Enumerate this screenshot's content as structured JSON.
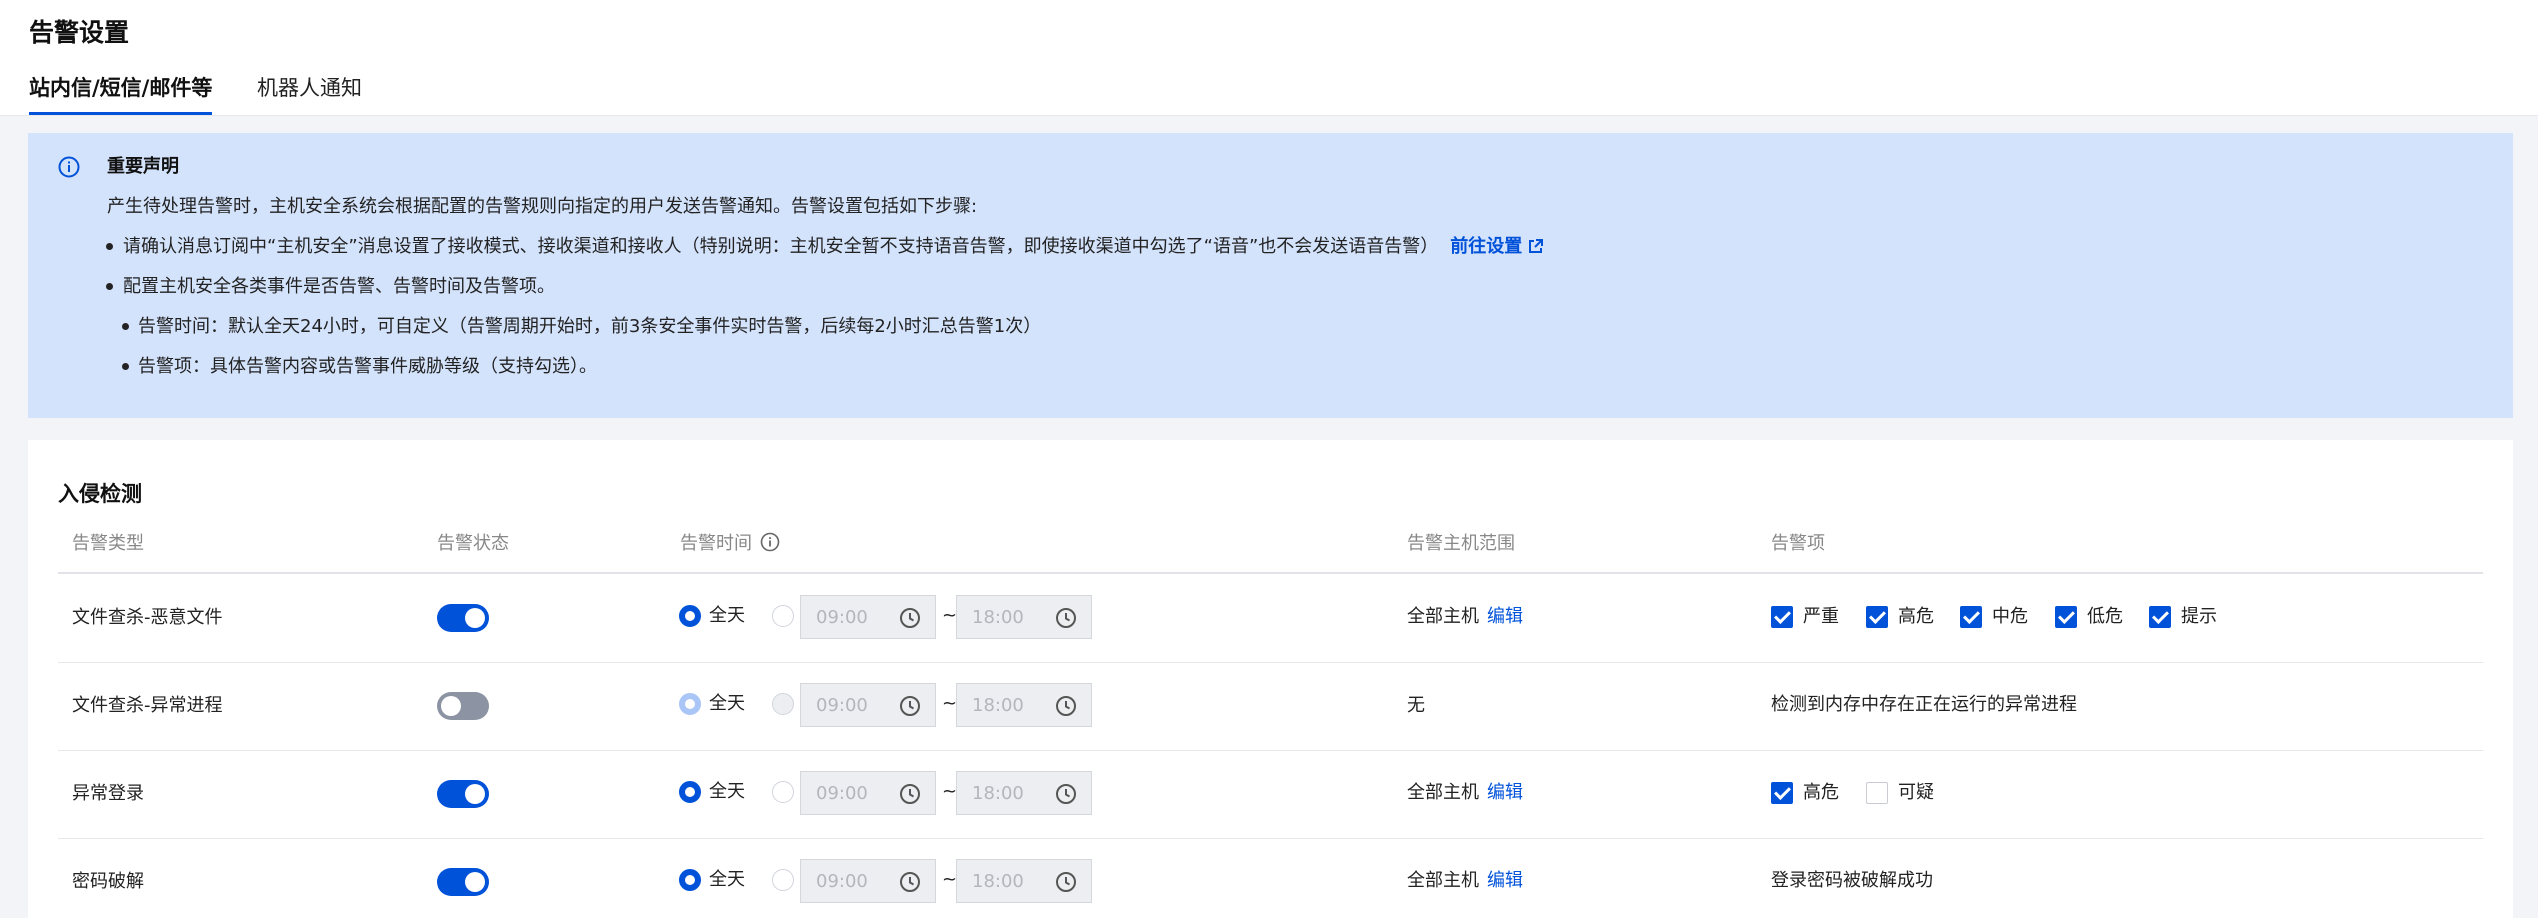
{
  "page": {
    "title": "告警设置"
  },
  "tabs": [
    {
      "label": "站内信/短信/邮件等",
      "active": true
    },
    {
      "label": "机器人通知",
      "active": false
    }
  ],
  "notice": {
    "title": "重要声明",
    "intro": "产生待处理告警时，主机安全系统会根据配置的告警规则向指定的用户发送告警通知。告警设置包括如下步骤:",
    "step1": "请确认消息订阅中“主机安全”消息设置了接收模式、接收渠道和接收人（特别说明：主机安全暂不支持语音告警，即使接收渠道中勾选了“语音”也不会发送语音告警）",
    "step1_link": "前往设置",
    "step2": "配置主机安全各类事件是否告警、告警时间及告警项。",
    "sub1": "告警时间：默认全天24小时，可自定义（告警周期开始时，前3条安全事件实时告警，后续每2小时汇总告警1次）",
    "sub2": "告警项：具体告警内容或告警事件威胁等级（支持勾选）。"
  },
  "section": {
    "title": "入侵检测",
    "columns": {
      "type": "告警类型",
      "status": "告警状态",
      "time": "告警时间",
      "scope": "告警主机范围",
      "items": "告警项"
    },
    "rows": [
      {
        "type": "文件查杀-恶意文件",
        "enabled": true,
        "all_day_label": "全天",
        "start": "09:00",
        "end": "18:00",
        "tilde": "~",
        "scope": "全部主机",
        "edit": "编辑",
        "items": [
          {
            "label": "严重",
            "checked": true
          },
          {
            "label": "高危",
            "checked": true
          },
          {
            "label": "中危",
            "checked": true
          },
          {
            "label": "低危",
            "checked": true
          },
          {
            "label": "提示",
            "checked": true
          }
        ]
      },
      {
        "type": "文件查杀-异常进程",
        "enabled": false,
        "all_day_label": "全天",
        "start": "09:00",
        "end": "18:00",
        "tilde": "~",
        "scope": "无",
        "items_text": "检测到内存中存在正在运行的异常进程"
      },
      {
        "type": "异常登录",
        "enabled": true,
        "all_day_label": "全天",
        "start": "09:00",
        "end": "18:00",
        "tilde": "~",
        "scope": "全部主机",
        "edit": "编辑",
        "items": [
          {
            "label": "高危",
            "checked": true
          },
          {
            "label": "可疑",
            "checked": false
          }
        ]
      },
      {
        "type": "密码破解",
        "enabled": true,
        "all_day_label": "全天",
        "start": "09:00",
        "end": "18:00",
        "tilde": "~",
        "scope": "全部主机",
        "edit": "编辑",
        "items_text": "登录密码被破解成功"
      }
    ]
  },
  "colors": {
    "primary": "#0052d9",
    "notice_bg": "#d4e3fc",
    "toggle_off": "#8c93a2"
  },
  "icons": [
    "info-icon",
    "external-link-icon",
    "help-circle-icon",
    "clock-icon"
  ]
}
